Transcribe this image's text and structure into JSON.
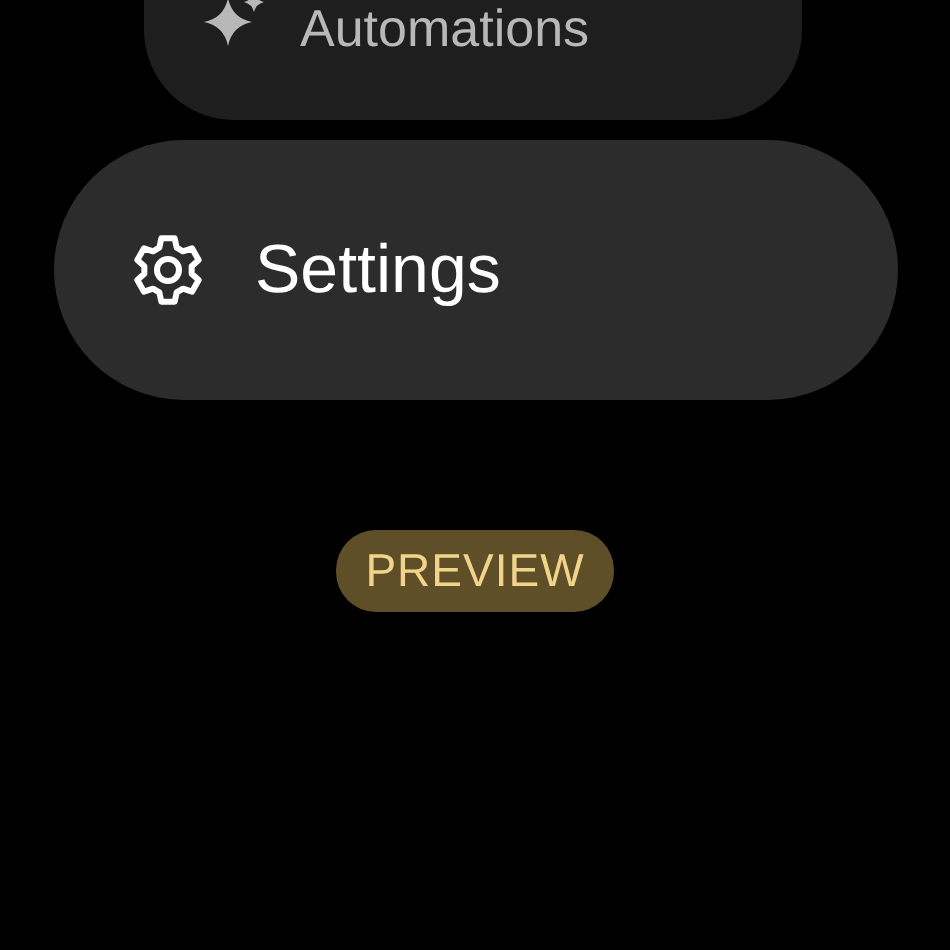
{
  "menu": [
    {
      "label": "Automations",
      "kind": "sparkle"
    },
    {
      "label": "Settings",
      "kind": "gear"
    }
  ],
  "badge": {
    "label": "PREVIEW"
  }
}
